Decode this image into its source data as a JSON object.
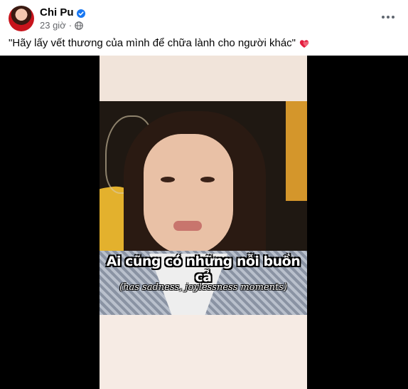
{
  "post": {
    "author": "Chi Pu",
    "verified": true,
    "time": "23 giờ",
    "privacy_icon": "globe-icon",
    "more_icon": "more-options-icon",
    "caption": "\"Hãy lấy vết thương của mình để chữa lành cho người khác\"",
    "caption_emoji_icon": "heart-icon"
  },
  "video": {
    "subtitle_main": "Ai cũng có những nỗi buồn cả",
    "subtitle_sub": "(has sadness, joylessness moments)"
  },
  "colors": {
    "verified_blue": "#1877f2",
    "meta_gray": "#65676b",
    "heart_red": "#e41e3f",
    "video_background": "#000000"
  }
}
